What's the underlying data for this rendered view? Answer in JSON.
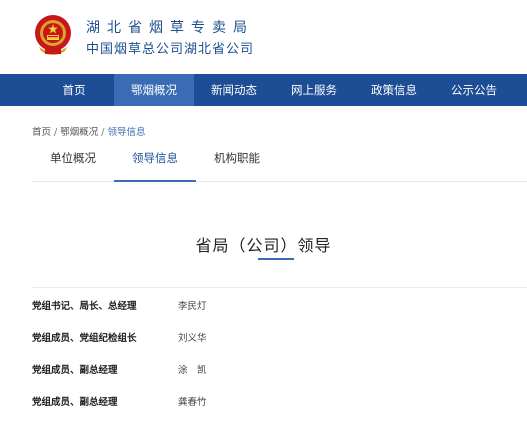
{
  "header": {
    "org_name_line1": "湖北省烟草专卖局",
    "org_name_line2": "中国烟草总公司湖北省公司",
    "emblem_icon": "national-emblem-icon"
  },
  "nav": {
    "items": [
      {
        "label": "首页"
      },
      {
        "label": "鄂烟概况"
      },
      {
        "label": "新闻动态"
      },
      {
        "label": "网上服务"
      },
      {
        "label": "政策信息"
      },
      {
        "label": "公示公告"
      }
    ],
    "active_label": "鄂烟概况"
  },
  "breadcrumb": {
    "home": "首页",
    "separator": "/",
    "parent": "鄂烟概况",
    "current": "领导信息"
  },
  "subtabs": [
    {
      "label": "单位概况"
    },
    {
      "label": "领导信息"
    },
    {
      "label": "机构职能"
    }
  ],
  "section": {
    "title": "省局（公司）领导"
  },
  "leaders": [
    {
      "title": "党组书记、局长、总经理",
      "name": "李民灯"
    },
    {
      "title": "党组成员、党组纪检组长",
      "name": "刘义华"
    },
    {
      "title": "党组成员、副总经理",
      "name": "涂　凯"
    },
    {
      "title": "党组成员、副总经理",
      "name": "龚春竹"
    }
  ],
  "colors": {
    "nav_bg": "#1c4d95",
    "nav_active": "#3a6cb6",
    "brand_text": "#1d4f8f",
    "accent": "#3a6cb6"
  }
}
